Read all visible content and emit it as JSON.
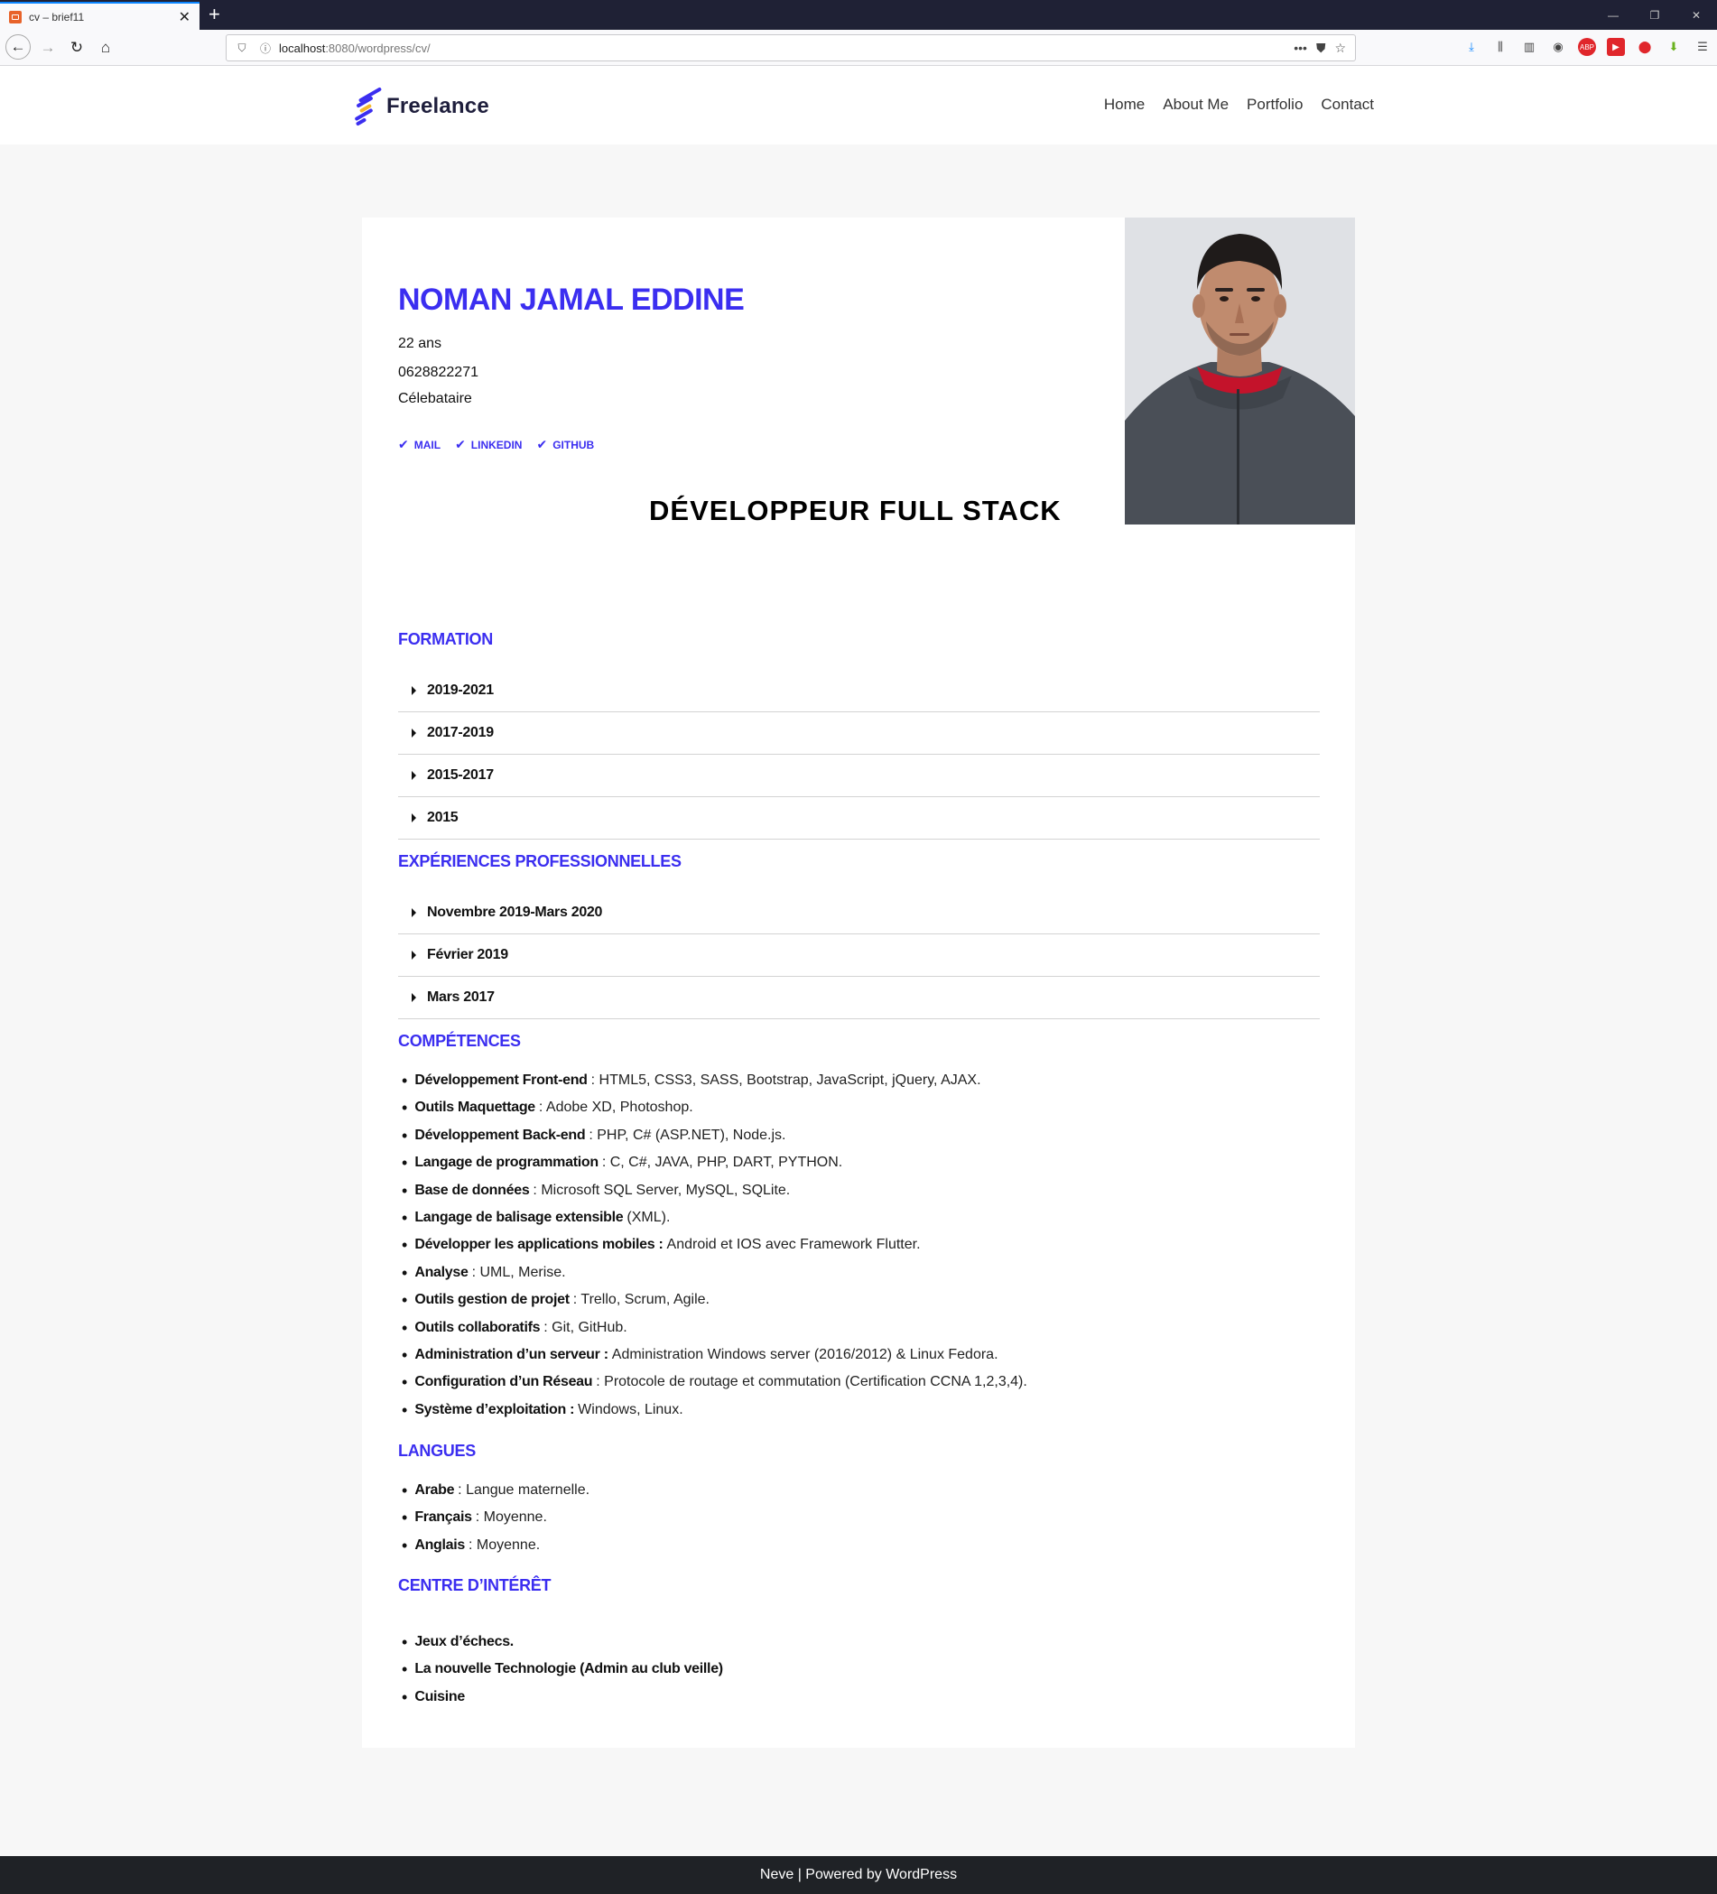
{
  "browser": {
    "tab_title": "cv – brief11",
    "url_host": "localhost",
    "url_rest": ":8080/wordpress/cv/",
    "more_icon": "•••"
  },
  "site": {
    "logo_text": "Freelance",
    "menu": [
      "Home",
      "About Me",
      "Portfolio",
      "Contact"
    ]
  },
  "cv": {
    "name": "NOMAN JAMAL EDDINE",
    "age": "22 ans",
    "phone": "0628822271",
    "status": "Célebataire",
    "links": [
      "MAIL",
      "LINKEDIN",
      "GITHUB"
    ],
    "job_title": "DÉVELOPPEUR FULL STACK"
  },
  "formation": {
    "title": "FORMATION",
    "items": [
      "2019-2021",
      "2017-2019",
      "2015-2017",
      "2015"
    ]
  },
  "experiences": {
    "title": "EXPÉRIENCES PROFESSIONNELLES",
    "items": [
      "Novembre 2019-Mars 2020",
      "Février 2019",
      "Mars 2017"
    ]
  },
  "competences": {
    "title": "COMPÉTENCES",
    "items": [
      {
        "label": "Développement Front-end",
        "text": ": HTML5, CSS3, SASS, Bootstrap, JavaScript, jQuery, AJAX."
      },
      {
        "label": "Outils Maquettage",
        "text": ": Adobe XD, Photoshop."
      },
      {
        "label": "Développement Back-end",
        "text": ": PHP, C# (ASP.NET), Node.js."
      },
      {
        "label": "Langage de programmation",
        "text": ": C, C#, JAVA, PHP, DART, PYTHON."
      },
      {
        "label": "Base de données",
        "text": ": Microsoft SQL Server, MySQL, SQLite."
      },
      {
        "label": "Langage de balisage extensible",
        "text": "(XML)."
      },
      {
        "label": "Développer les applications mobiles :",
        "text": "Android et IOS avec Framework Flutter."
      },
      {
        "label": "Analyse",
        "text": ": UML, Merise."
      },
      {
        "label": "Outils gestion de projet",
        "text": ": Trello, Scrum, Agile."
      },
      {
        "label": "Outils collaboratifs",
        "text": ": Git, GitHub."
      },
      {
        "label": "Administration d’un serveur :",
        "text": "Administration Windows server (2016/2012) & Linux Fedora."
      },
      {
        "label": "Configuration d’un Réseau",
        "text": ": Protocole de routage et commutation (Certification CCNA 1,2,3,4)."
      },
      {
        "label": "Système d’exploitation :",
        "text": "Windows, Linux."
      }
    ]
  },
  "langues": {
    "title": "LANGUES",
    "items": [
      {
        "label": "Arabe",
        "text": ": Langue maternelle."
      },
      {
        "label": "Français",
        "text": ": Moyenne."
      },
      {
        "label": "Anglais",
        "text": ": Moyenne."
      }
    ]
  },
  "interets": {
    "title": "CENTRE D’INTÉRÊT",
    "items": [
      "Jeux d’échecs.",
      "La nouvelle Technologie (Admin au club veille)",
      "Cuisine"
    ]
  },
  "footer": {
    "text": "Neve | Powered by WordPress"
  },
  "colors": {
    "accent": "#3b2ef0",
    "footer_bg": "#1f2226",
    "page_bg": "#f7f7f7"
  }
}
